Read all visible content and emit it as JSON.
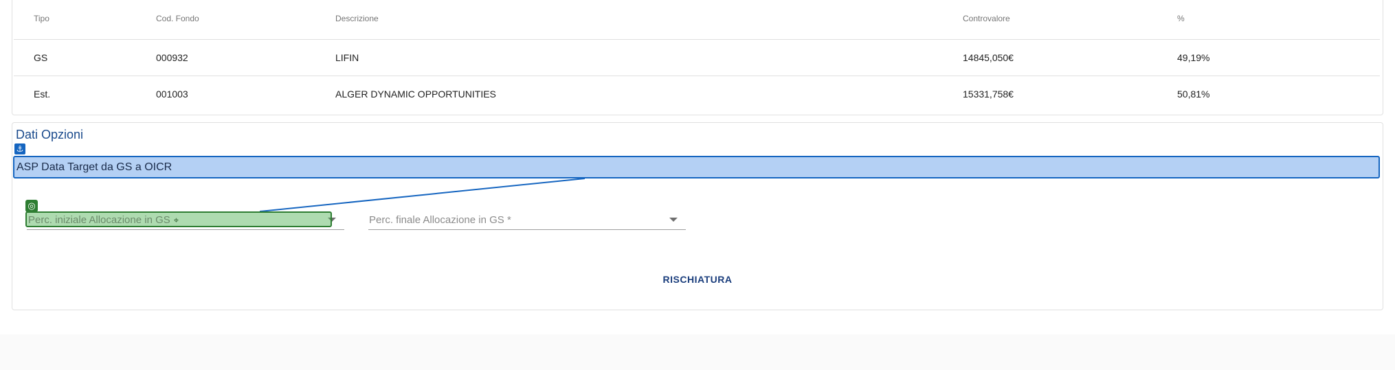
{
  "table": {
    "headers": {
      "tipo": "Tipo",
      "cod": "Cod. Fondo",
      "desc": "Descrizione",
      "contro": "Controvalore",
      "perc": "%"
    },
    "rows": [
      {
        "tipo": "GS",
        "cod": "000932",
        "desc": "LIFIN",
        "contro": "14845,050€",
        "perc": "49,19%"
      },
      {
        "tipo": "Est.",
        "cod": "001003",
        "desc": "ALGER DYNAMIC OPPORTUNITIES",
        "contro": "15331,758€",
        "perc": "50,81%"
      }
    ]
  },
  "options": {
    "title": "Dati Opzioni",
    "asp_label": "ASP Data Target da GS a OICR",
    "field_initial_placeholder": "Perc. iniziale Allocazione in GS",
    "field_final_placeholder": "Perc. finale Allocazione in GS *",
    "button_label": "RISCHIATURA"
  },
  "icons": {
    "anchor": "anchor-icon",
    "target": "target-icon",
    "crosshair": "crosshair-icon",
    "dropdown": "chevron-down-icon"
  },
  "colors": {
    "accent_blue": "#1565c0",
    "highlight_blue": "#b4d0f4",
    "highlight_green": "#4caf50",
    "title_blue": "#1a4a8c"
  }
}
